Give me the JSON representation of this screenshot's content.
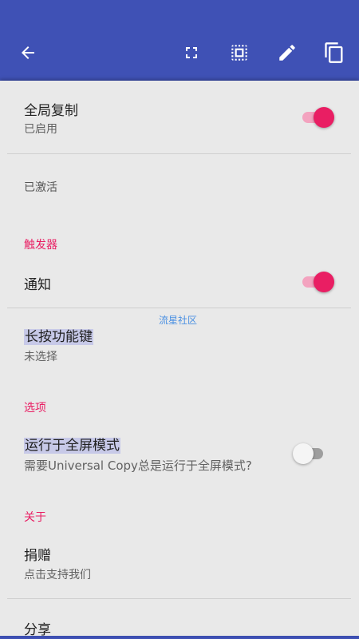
{
  "toolbar": {
    "back_icon": "arrow-back-icon",
    "icons": [
      "fullscreen-icon",
      "select-area-icon",
      "edit-icon",
      "copy-icon"
    ],
    "accent": "#3f51b5"
  },
  "settings": {
    "global_copy": {
      "title": "全局复制",
      "subtitle": "已启用",
      "enabled": true
    },
    "activated": {
      "text": "已激活"
    },
    "triggers_section": "触发器",
    "notification": {
      "title": "通知",
      "enabled": true
    },
    "long_press": {
      "title": "长按功能键",
      "subtitle": "未选择"
    },
    "options_section": "选项",
    "fullscreen_mode": {
      "title": "运行于全屏模式",
      "subtitle": "需要Universal Copy总是运行于全屏模式?",
      "enabled": false
    },
    "about_section": "关于",
    "donate": {
      "title": "捐赠",
      "subtitle": "点击支持我们"
    },
    "share": {
      "title": "分享"
    }
  },
  "watermark": "流星社区",
  "colors": {
    "switch_on": "#e91e63",
    "section_header": "#e91e63"
  }
}
